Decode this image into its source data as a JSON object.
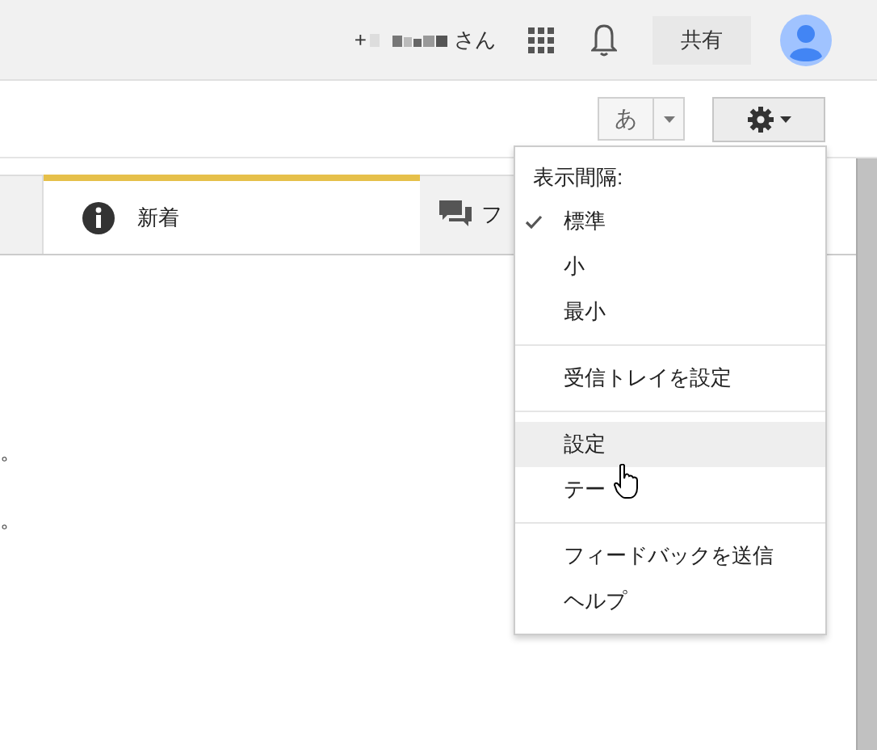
{
  "account": {
    "prefix": "+",
    "suffix": "さん"
  },
  "share_button": "共有",
  "input_tool_button": "あ",
  "tabs": [
    {
      "kind": "blank",
      "selected": false
    },
    {
      "kind": "info",
      "label": "新着",
      "selected": true
    },
    {
      "kind": "chat",
      "label": "フ",
      "selected": false
    }
  ],
  "content_lines": [
    "。",
    "。"
  ],
  "menu": {
    "header": "表示間隔:",
    "sections": [
      [
        {
          "label": "標準",
          "checked": true,
          "hovered": false
        },
        {
          "label": "小",
          "checked": false,
          "hovered": false
        },
        {
          "label": "最小",
          "checked": false,
          "hovered": false
        }
      ],
      [
        {
          "label": "受信トレイを設定",
          "hovered": false
        }
      ],
      [
        {
          "label": "設定",
          "hovered": true
        },
        {
          "label": "テー",
          "hovered": false
        }
      ],
      [
        {
          "label": "フィードバックを送信",
          "hovered": false
        },
        {
          "label": "ヘルプ",
          "hovered": false
        }
      ]
    ]
  }
}
